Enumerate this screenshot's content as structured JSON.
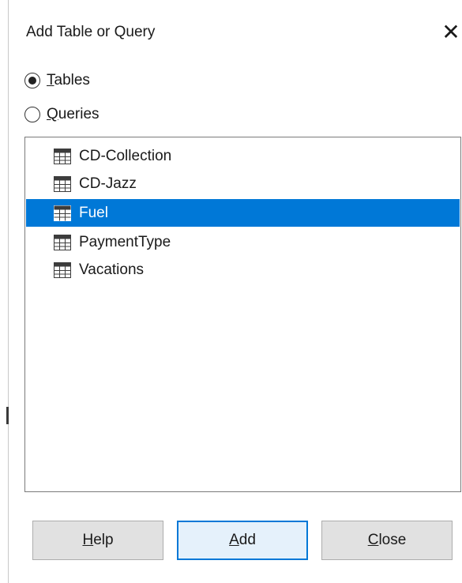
{
  "dialog": {
    "title": "Add Table or Query",
    "close_glyph": "✕"
  },
  "radios": [
    {
      "prefix": "",
      "mnemonic": "T",
      "rest": "ables",
      "selected": true
    },
    {
      "prefix": "",
      "mnemonic": "Q",
      "rest": "ueries",
      "selected": false
    }
  ],
  "list": {
    "items": [
      {
        "label": "CD-Collection",
        "icon": "table-icon",
        "selected": false
      },
      {
        "label": "CD-Jazz",
        "icon": "table-icon",
        "selected": false
      },
      {
        "label": "Fuel",
        "icon": "table-icon",
        "selected": true
      },
      {
        "label": "PaymentType",
        "icon": "table-icon",
        "selected": false
      },
      {
        "label": "Vacations",
        "icon": "table-icon",
        "selected": false
      }
    ]
  },
  "buttons": {
    "help": {
      "mnemonic": "H",
      "rest": "elp"
    },
    "add": {
      "mnemonic": "A",
      "rest": "dd"
    },
    "close": {
      "mnemonic": "C",
      "rest": "lose"
    }
  },
  "colors": {
    "selection": "#0078d7",
    "button_bg": "#e1e1e1",
    "default_button_border": "#0078d7"
  }
}
